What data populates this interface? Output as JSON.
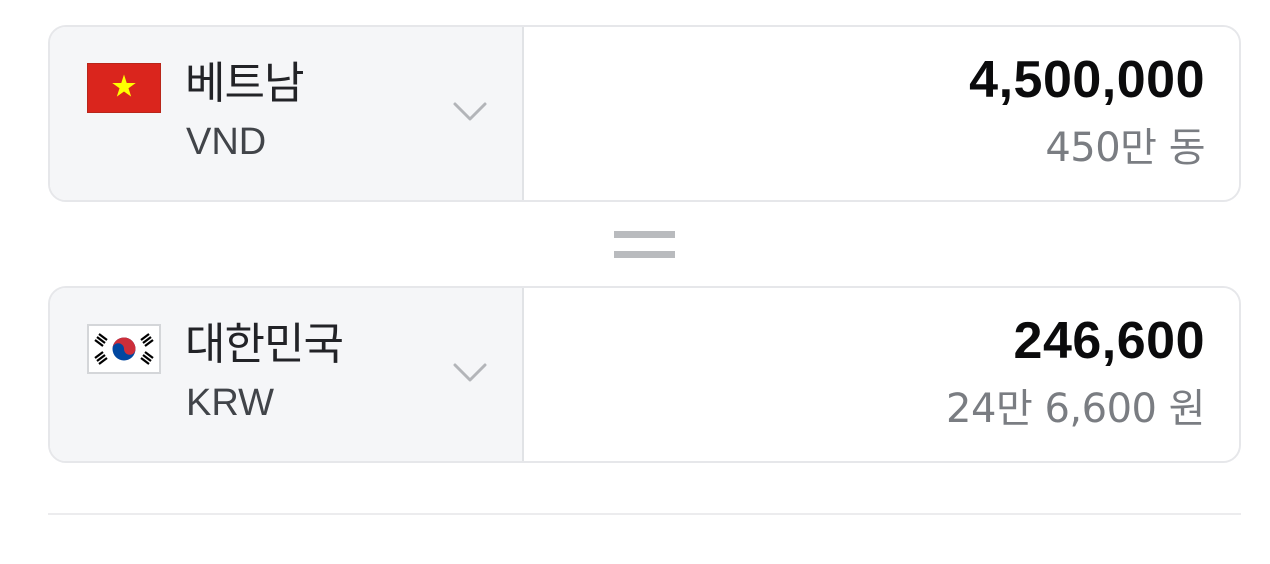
{
  "converter": {
    "from": {
      "country": "베트남",
      "code": "VND",
      "flag": "vietnam-flag",
      "amount": "4,500,000",
      "amount_korean": "450만 동"
    },
    "to": {
      "country": "대한민국",
      "code": "KRW",
      "flag": "south-korea-flag",
      "amount": "246,600",
      "amount_korean": "24만 6,600 원"
    },
    "equals_icon": "equals-icon",
    "dropdown_icon": "chevron-down-icon"
  },
  "colors": {
    "select_background": "#f5f6f8",
    "border": "#e6e7ea",
    "amount_text": "#0b0b0c",
    "secondary_text": "#7a7d82",
    "equals": "#b9bbbe"
  }
}
